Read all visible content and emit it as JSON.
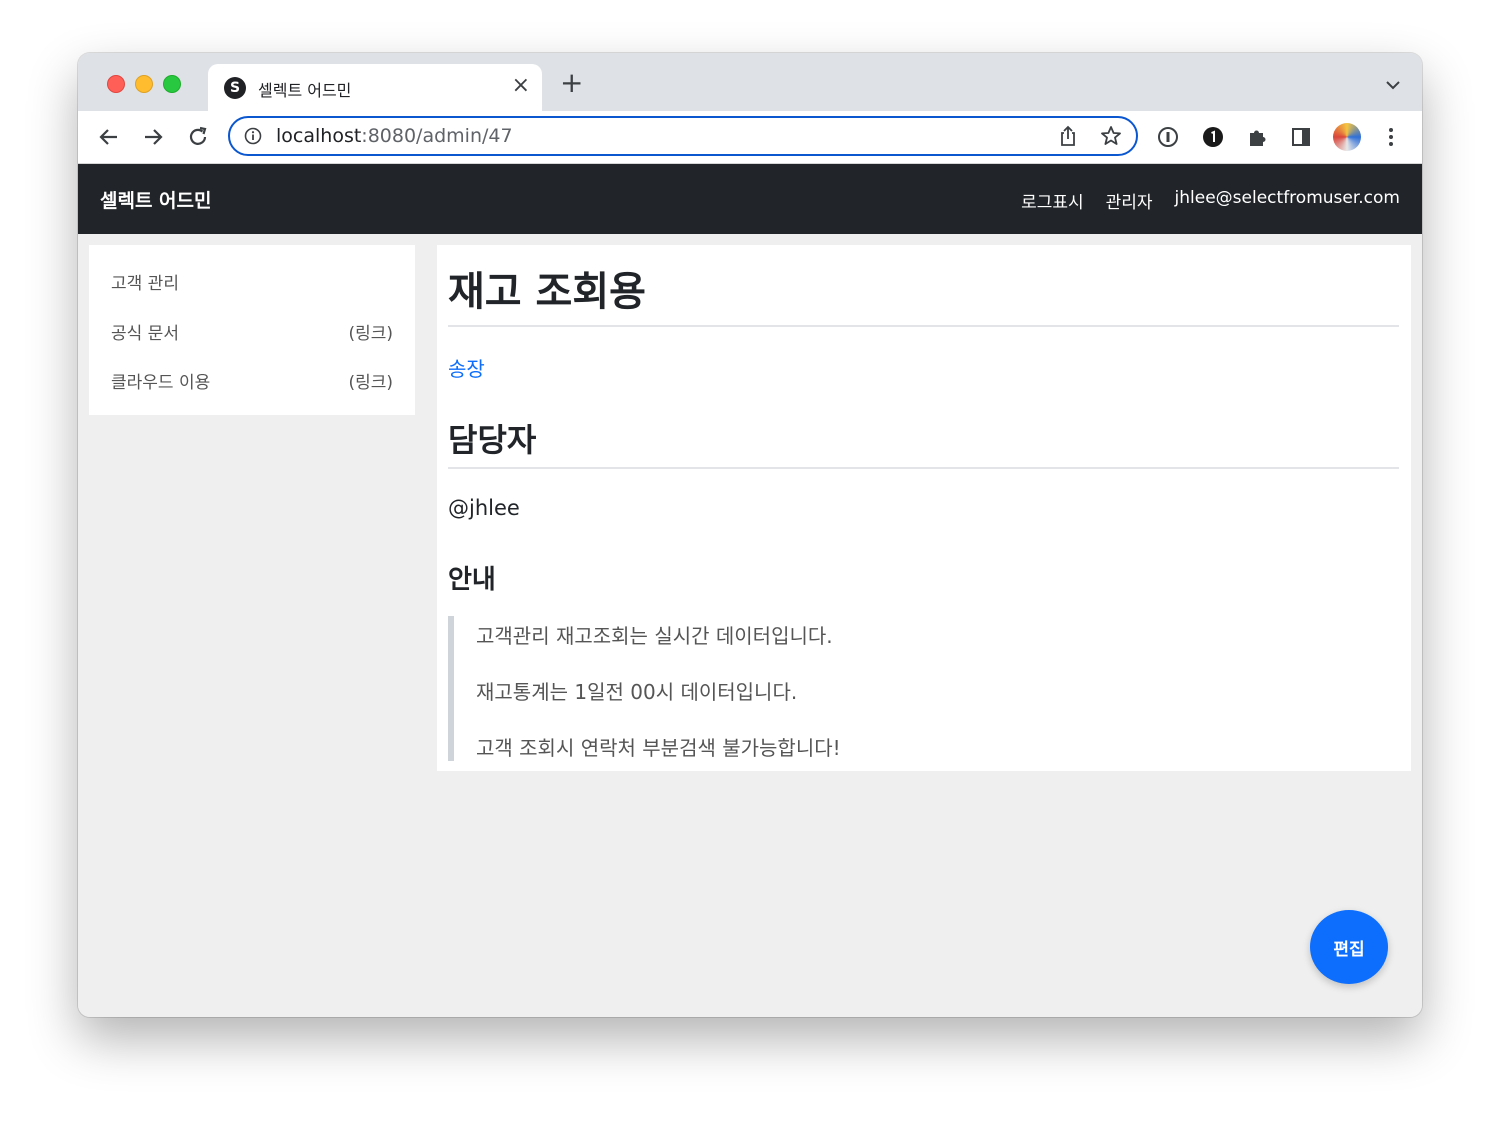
{
  "browser": {
    "tab_title": "셀렉트 어드민",
    "favicon_letter": "S",
    "tab_close": "×",
    "new_tab": "+",
    "url_host": "localhost",
    "url_path": ":8080/admin/47"
  },
  "navbar": {
    "brand": "셀렉트 어드민",
    "links": [
      "로그표시",
      "관리자",
      "jhlee@selectfromuser.com"
    ]
  },
  "sidebar": {
    "items": [
      {
        "label": "고객 관리",
        "suffix": ""
      },
      {
        "label": "공식 문서",
        "suffix": "(링크)"
      },
      {
        "label": "클라우드 이용",
        "suffix": "(링크)"
      }
    ]
  },
  "content": {
    "title": "재고 조회용",
    "link_text": "송장",
    "section_title": "담당자",
    "handle": "@jhlee",
    "notice_title": "안내",
    "notice_lines": [
      "고객관리 재고조회는 실시간 데이터입니다.",
      "재고통계는 1일전 00시 데이터입니다.",
      "고객 조회시 연락처 부분검색 불가능합니다!"
    ]
  },
  "fab": {
    "label": "편집"
  },
  "colors": {
    "navbar_bg": "#212529",
    "link": "#0d6efd",
    "fab_bg": "#0d6efd",
    "page_bg": "#efefef"
  }
}
